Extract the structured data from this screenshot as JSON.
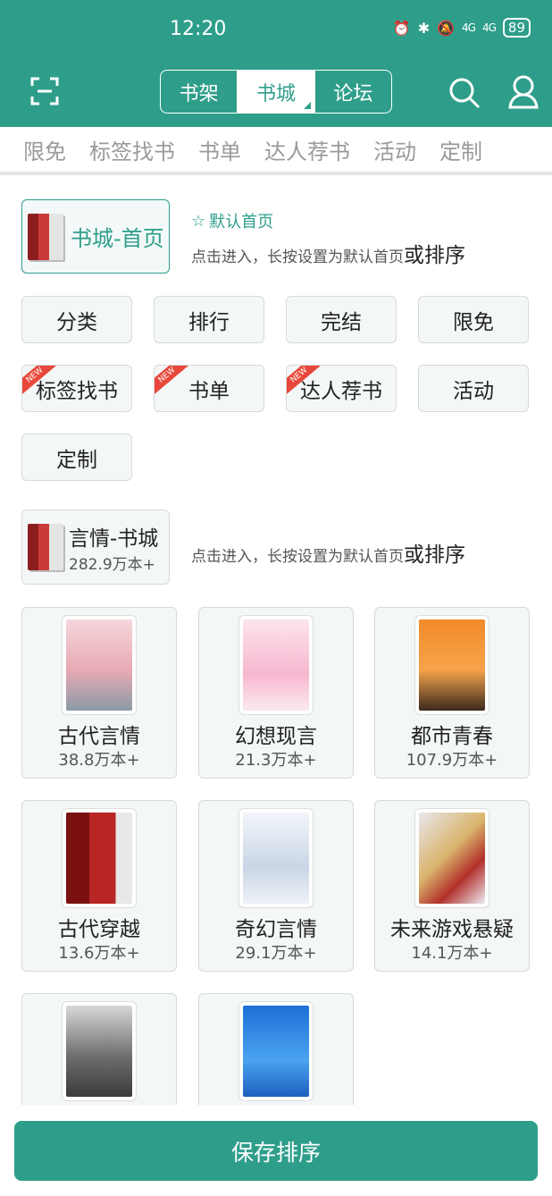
{
  "status": {
    "time": "12:20",
    "battery": "89",
    "net1": "4G",
    "net2": "4G"
  },
  "header": {
    "tabs": [
      {
        "label": "书架"
      },
      {
        "label": "书城"
      },
      {
        "label": "论坛"
      }
    ]
  },
  "subnav": [
    "限免",
    "标签找书",
    "书单",
    "达人荐书",
    "活动",
    "定制"
  ],
  "home_card": {
    "label": "书城-首页"
  },
  "default_home": {
    "star": "☆",
    "label": "默认首页"
  },
  "hint": {
    "text": "点击进入，长按设置为默认首页",
    "bold": "或排序"
  },
  "chips": [
    {
      "label": "分类",
      "new": false
    },
    {
      "label": "排行",
      "new": false
    },
    {
      "label": "完结",
      "new": false
    },
    {
      "label": "限免",
      "new": false
    },
    {
      "label": "标签找书",
      "new": true
    },
    {
      "label": "书单",
      "new": true
    },
    {
      "label": "达人荐书",
      "new": true
    },
    {
      "label": "活动",
      "new": false
    },
    {
      "label": "定制",
      "new": false
    }
  ],
  "new_badge": "NEW",
  "yq_card": {
    "title": "言情-书城",
    "count": "282.9万本+"
  },
  "categories": [
    {
      "name": "古代言情",
      "count": "38.8万本+"
    },
    {
      "name": "幻想现言",
      "count": "21.3万本+"
    },
    {
      "name": "都市青春",
      "count": "107.9万本+"
    },
    {
      "name": "古代穿越",
      "count": "13.6万本+"
    },
    {
      "name": "奇幻言情",
      "count": "29.1万本+"
    },
    {
      "name": "未来游戏悬疑",
      "count": "14.1万本+"
    },
    {
      "name": "",
      "count": ""
    },
    {
      "name": "",
      "count": ""
    }
  ],
  "save_button": "保存排序",
  "colors": {
    "brand": "#2e9e8a",
    "badge": "#e8483b"
  }
}
